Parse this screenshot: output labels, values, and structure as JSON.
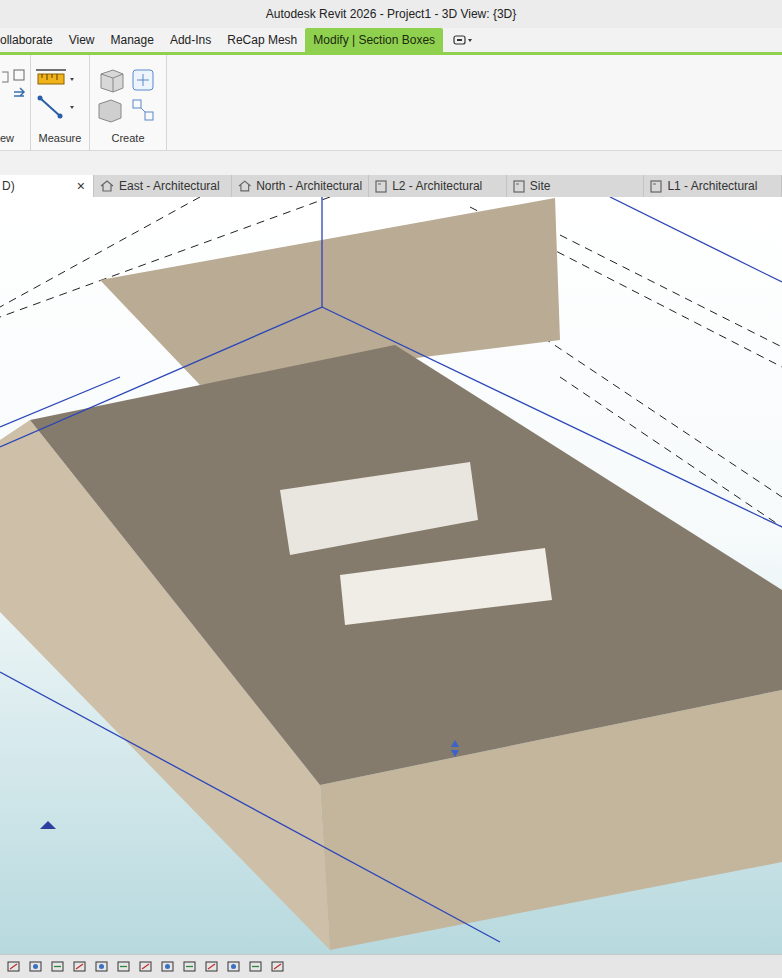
{
  "window": {
    "title": "Autodesk Revit 2026 - Project1 - 3D View: {3D}"
  },
  "ribbon_tabs": [
    {
      "label": "ollaborate",
      "selected": false
    },
    {
      "label": "View",
      "selected": false
    },
    {
      "label": "Manage",
      "selected": false
    },
    {
      "label": "Add-Ins",
      "selected": false
    },
    {
      "label": "ReCap Mesh",
      "selected": false
    },
    {
      "label": "Modify | Section Boxes",
      "selected": true
    }
  ],
  "ribbon_panels": [
    {
      "label": "ew"
    },
    {
      "label": "Measure"
    },
    {
      "label": "Create"
    }
  ],
  "view_tab_close": "×",
  "view_tabs": [
    {
      "label": "D)",
      "kind": "3d",
      "selected": true
    },
    {
      "label": "East - Architectural",
      "kind": "elevation",
      "selected": false
    },
    {
      "label": "North - Architectural",
      "kind": "elevation",
      "selected": false
    },
    {
      "label": "L2 - Architectural",
      "kind": "plan",
      "selected": false
    },
    {
      "label": "Site",
      "kind": "plan",
      "selected": false
    },
    {
      "label": "L1 - Architectural",
      "kind": "plan",
      "selected": false
    }
  ]
}
